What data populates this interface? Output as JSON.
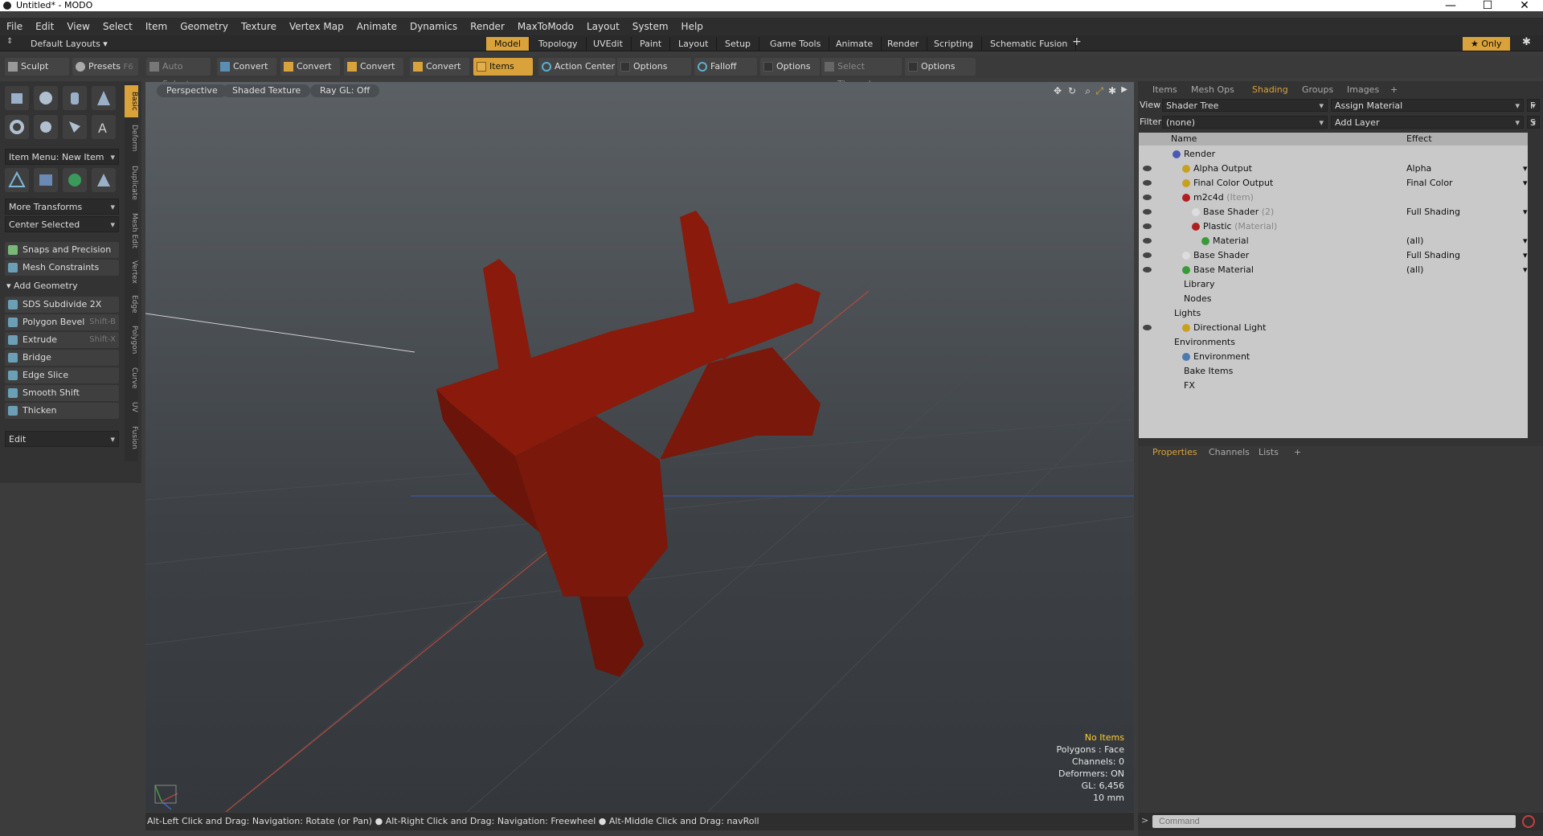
{
  "window": {
    "title": "Untitled* - MODO",
    "minimize": "—",
    "maximize": "☐",
    "close": "✕"
  },
  "menu": [
    "File",
    "Edit",
    "View",
    "Select",
    "Item",
    "Geometry",
    "Texture",
    "Vertex Map",
    "Animate",
    "Dynamics",
    "Render",
    "MaxToModo",
    "Layout",
    "System",
    "Help"
  ],
  "layout_bar": {
    "layouts_label": "Default Layouts ▾",
    "tabs": [
      "Model",
      "Topology",
      "UVEdit",
      "Paint",
      "Layout",
      "Setup",
      "Game Tools",
      "Animate",
      "Render",
      "Scripting",
      "Schematic Fusion"
    ],
    "active_tab": "Model",
    "add": "+",
    "only": "★ Only",
    "gear": "✱"
  },
  "toolbar": {
    "sculpt": "Sculpt",
    "presets": "Presets",
    "presets_key": "F6",
    "auto_select": "Auto Select",
    "convert1": "Convert",
    "convert2": "Convert",
    "convert3": "Convert",
    "convert4": "Convert",
    "items": "Items",
    "action_center": "Action Center",
    "options1": "Options",
    "falloff": "Falloff",
    "options2": "Options",
    "select_through": "Select Through",
    "options3": "Options"
  },
  "left_panel": {
    "vtabs": [
      "Basic",
      "Deform",
      "Duplicate",
      "Mesh Edit",
      "Vertex",
      "Edge",
      "Polygon",
      "Curve",
      "UV",
      "Fusion"
    ],
    "item_menu": "Item Menu: New Item",
    "more_transforms": "More Transforms",
    "center_selected": "Center Selected",
    "snaps": "Snaps and Precision",
    "mesh_constraints": "Mesh Constraints",
    "add_geometry": "Add Geometry",
    "tools": [
      {
        "label": "SDS Subdivide 2X",
        "shortcut": ""
      },
      {
        "label": "Polygon Bevel",
        "shortcut": "Shift-B"
      },
      {
        "label": "Extrude",
        "shortcut": "Shift-X"
      },
      {
        "label": "Bridge",
        "shortcut": ""
      },
      {
        "label": "Edge Slice",
        "shortcut": ""
      },
      {
        "label": "Smooth Shift",
        "shortcut": ""
      },
      {
        "label": "Thicken",
        "shortcut": ""
      }
    ],
    "edit": "Edit"
  },
  "viewport": {
    "perspective": "Perspective",
    "shaded_texture": "Shaded Texture",
    "ray_gl": "Ray GL: Off",
    "stats": {
      "items": "No Items",
      "polygons": "Polygons : Face",
      "channels": "Channels: 0",
      "deformers": "Deformers: ON",
      "gl": "GL: 6,456",
      "unit": "10 mm"
    },
    "model_color": "#8a1a0c"
  },
  "status": "Alt-Left Click and Drag: Navigation: Rotate (or Pan) ● Alt-Right Click and Drag: Navigation: Freewheel ● Alt-Middle Click and Drag: navRoll",
  "right_panel": {
    "tabs": [
      "Items",
      "Mesh Ops",
      "Shading",
      "Groups",
      "Images",
      "+"
    ],
    "active_tab": "Shading",
    "view_label": "View",
    "view_value": "Shader Tree",
    "assign_material": "Assign Material",
    "f_btn": "F",
    "filter_label": "Filter",
    "filter_value": "(none)",
    "add_layer": "Add Layer",
    "s_btn": "S",
    "col_name": "Name",
    "col_effect": "Effect",
    "tree": [
      {
        "name": "Render",
        "sub": "",
        "effect": "",
        "eye": false,
        "indent": 1,
        "color": "#4a5ab0"
      },
      {
        "name": "Alpha Output",
        "sub": "",
        "effect": "Alpha",
        "eye": true,
        "indent": 2,
        "color": "#c8a020"
      },
      {
        "name": "Final Color Output",
        "sub": "",
        "effect": "Final Color",
        "eye": true,
        "indent": 2,
        "color": "#c8a020"
      },
      {
        "name": "m2c4d",
        "sub": "(Item)",
        "effect": "",
        "eye": true,
        "indent": 2,
        "color": "#b02020"
      },
      {
        "name": "Base Shader",
        "sub": "(2)",
        "effect": "Full Shading",
        "eye": true,
        "indent": 3,
        "color": "#dddddd"
      },
      {
        "name": "Plastic",
        "sub": "(Material)",
        "effect": "",
        "eye": true,
        "indent": 3,
        "color": "#b02020"
      },
      {
        "name": "Material",
        "sub": "",
        "effect": "(all)",
        "eye": true,
        "indent": 4,
        "color": "#3a9a3a"
      },
      {
        "name": "Base Shader",
        "sub": "",
        "effect": "Full Shading",
        "eye": true,
        "indent": 2,
        "color": "#dddddd"
      },
      {
        "name": "Base Material",
        "sub": "",
        "effect": "(all)",
        "eye": true,
        "indent": 2,
        "color": "#3a9a3a"
      },
      {
        "name": "Library",
        "sub": "",
        "effect": "",
        "eye": false,
        "indent": 1,
        "color": ""
      },
      {
        "name": "Nodes",
        "sub": "",
        "effect": "",
        "eye": false,
        "indent": 1,
        "color": ""
      },
      {
        "name": "Lights",
        "sub": "",
        "effect": "",
        "eye": false,
        "indent": 0,
        "color": ""
      },
      {
        "name": "Directional Light",
        "sub": "",
        "effect": "",
        "eye": true,
        "indent": 2,
        "color": "#c8a020"
      },
      {
        "name": "Environments",
        "sub": "",
        "effect": "",
        "eye": false,
        "indent": 0,
        "color": ""
      },
      {
        "name": "Environment",
        "sub": "",
        "effect": "",
        "eye": false,
        "indent": 2,
        "color": "#4a7ab0"
      },
      {
        "name": "Bake Items",
        "sub": "",
        "effect": "",
        "eye": false,
        "indent": 1,
        "color": ""
      },
      {
        "name": "FX",
        "sub": "",
        "effect": "",
        "eye": false,
        "indent": 1,
        "color": ""
      }
    ],
    "prop_tabs": [
      "Properties",
      "Channels",
      "Lists",
      "+"
    ],
    "prop_active": "Properties",
    "command_placeholder": "Command",
    "cmd_prompt": ">"
  }
}
